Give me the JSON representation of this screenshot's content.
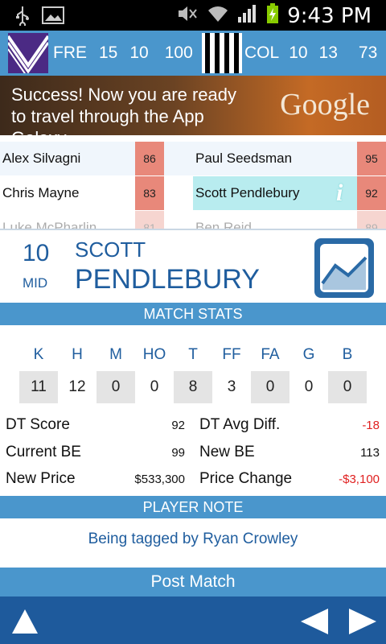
{
  "status_bar": {
    "time": "9:43 PM",
    "icons": [
      "usb-icon",
      "image-icon",
      "mute-icon",
      "wifi-icon",
      "signal-icon",
      "battery-charging-icon"
    ]
  },
  "score_bar": {
    "home": {
      "code": "FRE",
      "goals": "15",
      "behinds": "10",
      "total": "100"
    },
    "away": {
      "code": "COL",
      "goals": "10",
      "behinds": "13",
      "total": "73"
    }
  },
  "ad": {
    "text": "Success! Now you are ready to travel through the App Galaxy.",
    "brand": "Google"
  },
  "player_list": {
    "left": [
      {
        "name": "Alex Silvagni",
        "score": "86"
      },
      {
        "name": "Chris Mayne",
        "score": "83"
      },
      {
        "name": "Luke McPharlin",
        "score": "81"
      }
    ],
    "right": [
      {
        "name": "Paul Seedsman",
        "score": "95"
      },
      {
        "name": "Scott Pendlebury",
        "score": "92"
      },
      {
        "name": "Ben Reid",
        "score": "89"
      }
    ],
    "info_glyph": "i"
  },
  "player": {
    "number": "10",
    "position": "MID",
    "first_name": "SCOTT",
    "last_name": "PENDLEBURY"
  },
  "match_stats": {
    "title": "MATCH STATS",
    "headers": [
      "K",
      "H",
      "M",
      "HO",
      "T",
      "FF",
      "FA",
      "G",
      "B"
    ],
    "values": [
      "11",
      "12",
      "0",
      "0",
      "8",
      "3",
      "0",
      "0",
      "0"
    ]
  },
  "details": {
    "dt_score_label": "DT Score",
    "dt_score": "92",
    "dt_avg_label": "DT Avg Diff.",
    "dt_avg": "-18",
    "current_be_label": "Current BE",
    "current_be": "99",
    "new_be_label": "New BE",
    "new_be": "113",
    "new_price_label": "New Price",
    "new_price": "$533,300",
    "price_change_label": "Price Change",
    "price_change": "-$3,100"
  },
  "player_note": {
    "title": "PLAYER NOTE",
    "text": "Being tagged by Ryan Crowley"
  },
  "post_match": "Post Match",
  "colors": {
    "accent": "#4a96cc",
    "dark_accent": "#1e5a9c",
    "text_blue": "#1f5d9e",
    "score_pill": "#e8887a",
    "negative": "#e02020"
  }
}
